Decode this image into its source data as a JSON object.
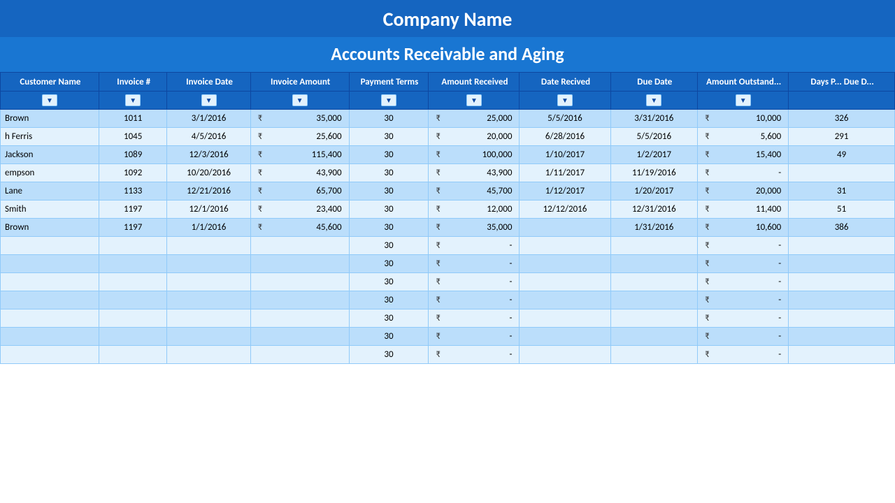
{
  "header": {
    "company": "Company Name",
    "title": "Accounts Receivable and Aging"
  },
  "columns": [
    {
      "id": "customer",
      "label": "Customer Name"
    },
    {
      "id": "invoice_num",
      "label": "Invoice #"
    },
    {
      "id": "invoice_date",
      "label": "Invoice Date"
    },
    {
      "id": "invoice_amount",
      "label": "Invoice Amount"
    },
    {
      "id": "payment_terms",
      "label": "Payment Terms"
    },
    {
      "id": "amount_received",
      "label": "Amount Received"
    },
    {
      "id": "date_received",
      "label": "Date Recived"
    },
    {
      "id": "due_date",
      "label": "Due Date"
    },
    {
      "id": "amount_outstanding",
      "label": "Amount Outstand..."
    },
    {
      "id": "days_due",
      "label": "Days P... Due D..."
    }
  ],
  "rows": [
    {
      "customer": "Brown",
      "invoice_num": "1011",
      "invoice_date": "3/1/2016",
      "invoice_amount": "35,000",
      "payment_terms": "30",
      "amount_received": "25,000",
      "date_received": "5/5/2016",
      "due_date": "3/31/2016",
      "amount_outstanding": "10,000",
      "days_due": "326"
    },
    {
      "customer": "h Ferris",
      "invoice_num": "1045",
      "invoice_date": "4/5/2016",
      "invoice_amount": "25,600",
      "payment_terms": "30",
      "amount_received": "20,000",
      "date_received": "6/28/2016",
      "due_date": "5/5/2016",
      "amount_outstanding": "5,600",
      "days_due": "291"
    },
    {
      "customer": "Jackson",
      "invoice_num": "1089",
      "invoice_date": "12/3/2016",
      "invoice_amount": "115,400",
      "payment_terms": "30",
      "amount_received": "100,000",
      "date_received": "1/10/2017",
      "due_date": "1/2/2017",
      "amount_outstanding": "15,400",
      "days_due": "49"
    },
    {
      "customer": "empson",
      "invoice_num": "1092",
      "invoice_date": "10/20/2016",
      "invoice_amount": "43,900",
      "payment_terms": "30",
      "amount_received": "43,900",
      "date_received": "1/11/2017",
      "due_date": "11/19/2016",
      "amount_outstanding": "-",
      "days_due": ""
    },
    {
      "customer": "Lane",
      "invoice_num": "1133",
      "invoice_date": "12/21/2016",
      "invoice_amount": "65,700",
      "payment_terms": "30",
      "amount_received": "45,700",
      "date_received": "1/12/2017",
      "due_date": "1/20/2017",
      "amount_outstanding": "20,000",
      "days_due": "31"
    },
    {
      "customer": "Smith",
      "invoice_num": "1197",
      "invoice_date": "12/1/2016",
      "invoice_amount": "23,400",
      "payment_terms": "30",
      "amount_received": "12,000",
      "date_received": "12/12/2016",
      "due_date": "12/31/2016",
      "amount_outstanding": "11,400",
      "days_due": "51"
    },
    {
      "customer": "Brown",
      "invoice_num": "1197",
      "invoice_date": "1/1/2016",
      "invoice_amount": "45,600",
      "payment_terms": "30",
      "amount_received": "35,000",
      "date_received": "",
      "due_date": "1/31/2016",
      "amount_outstanding": "10,600",
      "days_due": "386"
    },
    {
      "customer": "",
      "invoice_num": "",
      "invoice_date": "",
      "invoice_amount": "",
      "payment_terms": "30",
      "amount_received": "-",
      "date_received": "",
      "due_date": "",
      "amount_outstanding": "-",
      "days_due": ""
    },
    {
      "customer": "",
      "invoice_num": "",
      "invoice_date": "",
      "invoice_amount": "",
      "payment_terms": "30",
      "amount_received": "-",
      "date_received": "",
      "due_date": "",
      "amount_outstanding": "-",
      "days_due": ""
    },
    {
      "customer": "",
      "invoice_num": "",
      "invoice_date": "",
      "invoice_amount": "",
      "payment_terms": "30",
      "amount_received": "-",
      "date_received": "",
      "due_date": "",
      "amount_outstanding": "-",
      "days_due": ""
    },
    {
      "customer": "",
      "invoice_num": "",
      "invoice_date": "",
      "invoice_amount": "",
      "payment_terms": "30",
      "amount_received": "-",
      "date_received": "",
      "due_date": "",
      "amount_outstanding": "-",
      "days_due": ""
    },
    {
      "customer": "",
      "invoice_num": "",
      "invoice_date": "",
      "invoice_amount": "",
      "payment_terms": "30",
      "amount_received": "-",
      "date_received": "",
      "due_date": "",
      "amount_outstanding": "-",
      "days_due": ""
    },
    {
      "customer": "",
      "invoice_num": "",
      "invoice_date": "",
      "invoice_amount": "",
      "payment_terms": "30",
      "amount_received": "-",
      "date_received": "",
      "due_date": "",
      "amount_outstanding": "-",
      "days_due": ""
    },
    {
      "customer": "",
      "invoice_num": "",
      "invoice_date": "",
      "invoice_amount": "",
      "payment_terms": "30",
      "amount_received": "-",
      "date_received": "",
      "due_date": "",
      "amount_outstanding": "-",
      "days_due": ""
    }
  ],
  "currency_symbol": "₹",
  "filter_label": "▼"
}
